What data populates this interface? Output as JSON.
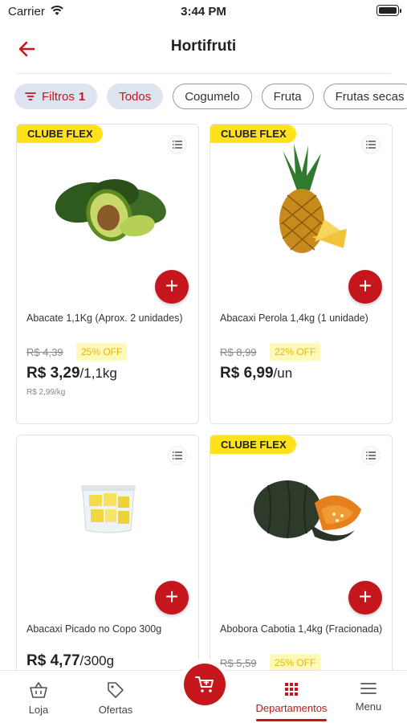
{
  "status_bar": {
    "carrier": "Carrier",
    "time": "3:44 PM"
  },
  "header": {
    "title": "Hortifruti"
  },
  "filters": {
    "filter_label": "Filtros",
    "filter_count": "1",
    "chips": [
      "Todos",
      "Cogumelo",
      "Fruta",
      "Frutas secas"
    ]
  },
  "products": [
    {
      "badge": "CLUBE FLEX",
      "name": "Abacate 1,1Kg (Aprox. 2 unidades)",
      "old_price": "R$ 4,39",
      "discount": "25% OFF",
      "price": "R$ 3,29",
      "unit": "/1,1kg",
      "per_kg": "R$ 2,99/kg",
      "image": "avocado"
    },
    {
      "badge": "CLUBE FLEX",
      "name": "Abacaxi Perola 1,4kg (1 unidade)",
      "old_price": "R$ 8,99",
      "discount": "22% OFF",
      "price": "R$ 6,99",
      "unit": "/un",
      "image": "pineapple"
    },
    {
      "name": "Abacaxi Picado no Copo 300g",
      "price": "R$ 4,77",
      "unit": "/300g",
      "image": "pineapple-cup"
    },
    {
      "badge": "CLUBE FLEX",
      "name": "Abobora Cabotia 1,4kg (Fracionada)",
      "old_price": "R$ 5,59",
      "discount": "25% OFF",
      "image": "pumpkin"
    }
  ],
  "bottom_nav": {
    "items": [
      "Loja",
      "Ofertas",
      "Departamentos",
      "Menu"
    ],
    "active": "Departamentos"
  },
  "colors": {
    "accent": "#c4161c",
    "badge": "#ffe21a",
    "chip_active_bg": "#dde3ef"
  }
}
